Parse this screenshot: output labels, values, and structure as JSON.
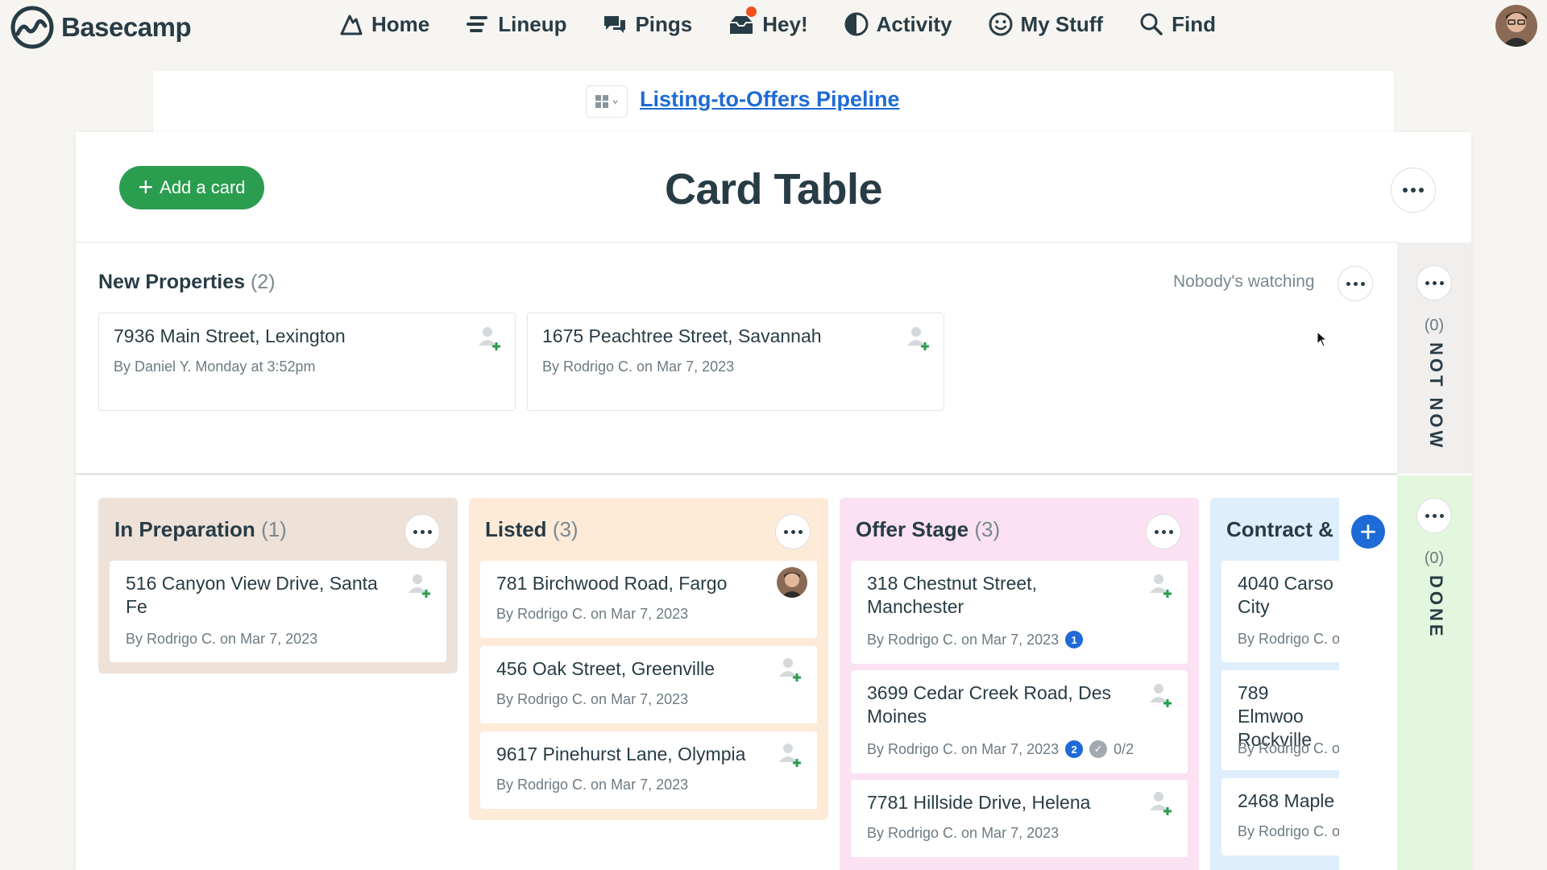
{
  "app": {
    "name": "Basecamp"
  },
  "nav": {
    "items": [
      {
        "label": "Home",
        "icon": "home-icon"
      },
      {
        "label": "Lineup",
        "icon": "lineup-icon"
      },
      {
        "label": "Pings",
        "icon": "pings-icon"
      },
      {
        "label": "Hey!",
        "icon": "hey-icon"
      },
      {
        "label": "Activity",
        "icon": "activity-icon"
      },
      {
        "label": "My Stuff",
        "icon": "my-stuff-icon"
      },
      {
        "label": "Find",
        "icon": "search-icon"
      }
    ]
  },
  "project": {
    "title": "Listing-to-Offers Pipeline"
  },
  "page": {
    "title": "Card Table",
    "add_label": "Add a card"
  },
  "triage": {
    "title": "New Properties",
    "count": "(2)",
    "watching": "Nobody's watching",
    "cards": [
      {
        "title": "7936 Main Street, Lexington",
        "meta": "By Daniel Y. Monday at 3:52pm"
      },
      {
        "title": "1675 Peachtree Street, Savannah",
        "meta": "By Rodrigo C. on Mar 7, 2023"
      }
    ]
  },
  "not_now": {
    "count": "(0)",
    "label": "NOT NOW"
  },
  "done": {
    "count": "(0)",
    "label": "DONE"
  },
  "columns": [
    {
      "title": "In Preparation",
      "count": "(1)",
      "color": "#ede1d8",
      "cards": [
        {
          "title": "516 Canyon View Drive, Santa Fe",
          "meta": "By Rodrigo C. on Mar 7, 2023"
        }
      ]
    },
    {
      "title": "Listed",
      "count": "(3)",
      "color": "#fdebd8",
      "cards": [
        {
          "title": "781 Birchwood Road, Fargo",
          "meta": "By Rodrigo C. on Mar 7, 2023"
        },
        {
          "title": "456 Oak Street, Greenville",
          "meta": "By Rodrigo C. on Mar 7, 2023"
        },
        {
          "title": "9617 Pinehurst Lane, Olympia",
          "meta": "By Rodrigo C. on Mar 7, 2023"
        }
      ]
    },
    {
      "title": "Offer Stage",
      "count": "(3)",
      "color": "#fbe1f1",
      "cards": [
        {
          "title": "318 Chestnut Street, Manchester",
          "meta": "By Rodrigo C. on Mar 7, 2023",
          "comments": "1"
        },
        {
          "title": "3699 Cedar Creek Road, Des Moines",
          "meta": "By Rodrigo C. on Mar 7, 2023",
          "comments": "2",
          "steps": "0/2"
        },
        {
          "title": "7781 Hillside Drive, Helena",
          "meta": "By Rodrigo C. on Mar 7, 2023"
        }
      ]
    },
    {
      "title": "Contract & C",
      "color": "#dfeefc",
      "cards": [
        {
          "title": "4040 Carso City",
          "meta": "By Rodrigo C. o"
        },
        {
          "title": "789 Elmwoo Rockville",
          "meta": "By Rodrigo C. o"
        },
        {
          "title": "2468 Maple",
          "meta": "By Rodrigo C. o"
        }
      ]
    }
  ]
}
